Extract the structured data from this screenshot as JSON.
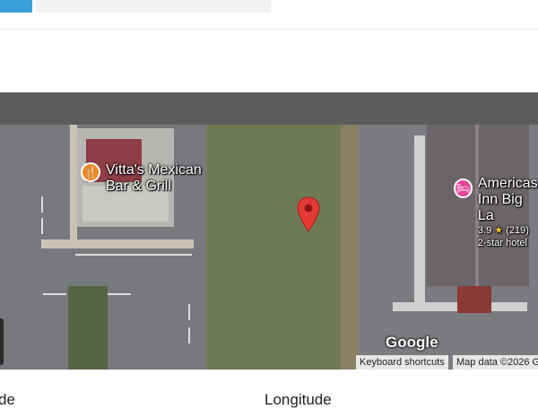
{
  "map": {
    "poi_restaurant": {
      "name_line1": "Vitta's Mexican",
      "name_line2": "Bar & Grill",
      "icon": "fork-knife-icon",
      "icon_color": "#f08a24"
    },
    "poi_hotel": {
      "name_line1": "Americas",
      "name_line2": "Inn Big La",
      "rating": "3.9",
      "reviews": "(219)",
      "type": "2-star hotel",
      "icon": "bed-icon",
      "icon_color": "#e2479a"
    },
    "marker_color": "#e53935",
    "logo": "Google",
    "keyboard_shortcuts": "Keyboard shortcuts",
    "map_data": "Map data ©2026 G"
  },
  "fields": {
    "latitude_label_fragment": "de",
    "longitude_label": "Longitude"
  },
  "colors": {
    "accent": "#3aa0d8",
    "header_bar": "#5c5c5c"
  }
}
